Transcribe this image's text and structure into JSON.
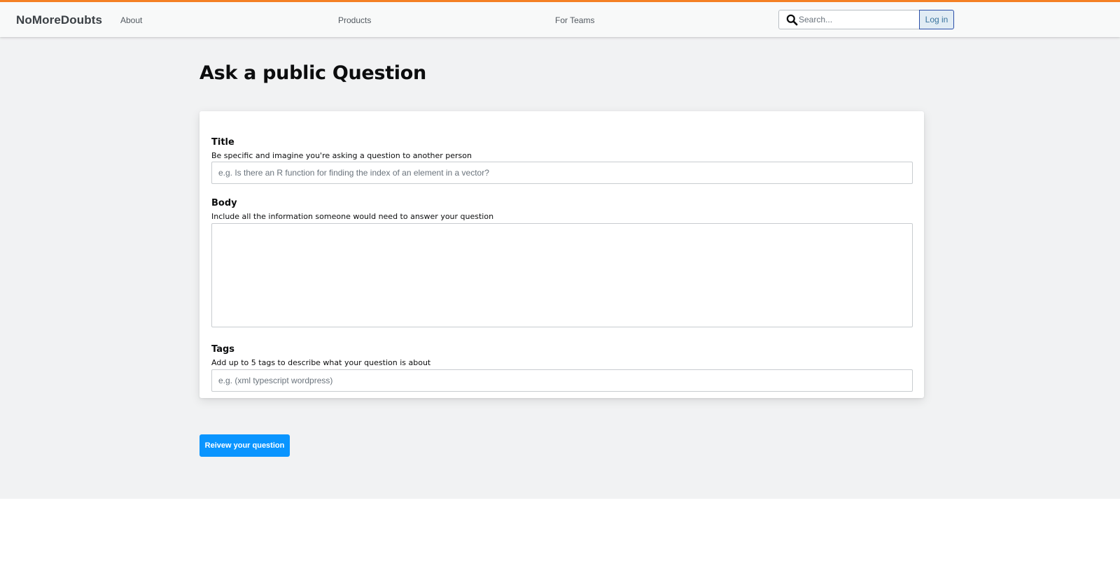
{
  "header": {
    "brand": "NoMoreDoubts",
    "nav": {
      "about": "About",
      "products": "Products",
      "for_teams": "For Teams"
    },
    "search": {
      "placeholder": "Search...",
      "value": "",
      "icon": "search-icon"
    },
    "login_label": "Log in",
    "accent_color": "#f48024"
  },
  "page": {
    "title": "Ask a public Question"
  },
  "form": {
    "title": {
      "label": "Title",
      "description": "Be specific and imagine you're asking a question to another person",
      "placeholder": "e.g. Is there an R function for finding the index of an element in a vector?",
      "value": ""
    },
    "body": {
      "label": "Body",
      "description": "Include all the information someone would need to answer your question",
      "value": ""
    },
    "tags": {
      "label": "Tags",
      "description": "Add up to 5 tags to describe what your question is about",
      "placeholder": "e.g. (xml typescript wordpress)",
      "value": ""
    }
  },
  "actions": {
    "submit_label": "Reivew your question",
    "submit_color": "#0a95ff"
  }
}
